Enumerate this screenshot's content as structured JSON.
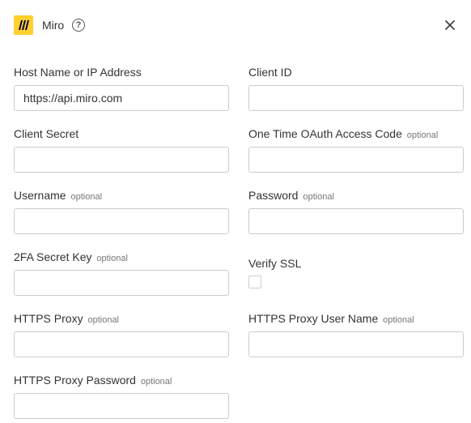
{
  "header": {
    "app_name": "Miro",
    "help_glyph": "?",
    "logo_icon": "miro-logo",
    "close_icon": "close-icon"
  },
  "optional_text": "optional",
  "fields": {
    "host": {
      "label": "Host Name or IP Address",
      "value": "https://api.miro.com"
    },
    "client_id": {
      "label": "Client ID",
      "value": ""
    },
    "client_secret": {
      "label": "Client Secret",
      "value": ""
    },
    "oauth_code": {
      "label": "One Time OAuth Access Code",
      "optional": "optional",
      "value": ""
    },
    "username": {
      "label": "Username",
      "optional": "optional",
      "value": ""
    },
    "password": {
      "label": "Password",
      "optional": "optional",
      "value": ""
    },
    "twofa": {
      "label": "2FA Secret Key",
      "optional": "optional",
      "value": ""
    },
    "verify_ssl": {
      "label": "Verify SSL",
      "checked": false
    },
    "https_proxy": {
      "label": "HTTPS Proxy",
      "optional": "optional",
      "value": ""
    },
    "proxy_user": {
      "label": "HTTPS Proxy User Name",
      "optional": "optional",
      "value": ""
    },
    "proxy_password": {
      "label": "HTTPS Proxy Password",
      "optional": "optional",
      "value": ""
    }
  },
  "colors": {
    "logo_bg": "#FFD02F",
    "logo_fg": "#050038",
    "border": "#cccccc",
    "text": "#333333",
    "muted": "#777777"
  }
}
